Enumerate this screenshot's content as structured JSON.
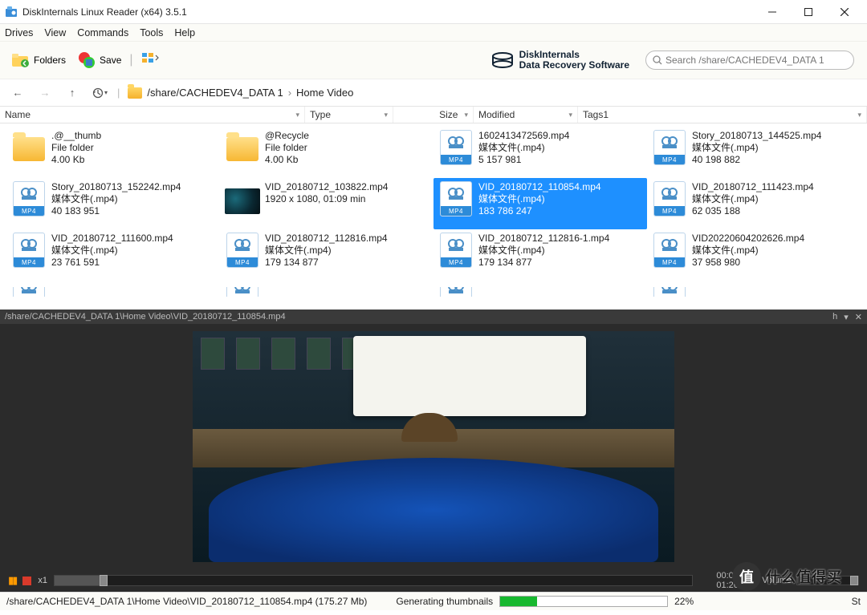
{
  "window": {
    "title": "DiskInternals Linux Reader (x64) 3.5.1"
  },
  "menu": {
    "drives": "Drives",
    "view": "View",
    "commands": "Commands",
    "tools": "Tools",
    "help": "Help"
  },
  "toolbar": {
    "folders": "Folders",
    "save": "Save"
  },
  "brand": {
    "line1": "DiskInternals",
    "line2": "Data Recovery Software"
  },
  "search": {
    "placeholder": "Search /share/CACHEDEV4_DATA 1"
  },
  "breadcrumb": {
    "seg1": "/share/CACHEDEV4_DATA 1",
    "seg2": "Home Video"
  },
  "columns": {
    "name": "Name",
    "type": "Type",
    "size": "Size",
    "modified": "Modified",
    "tags1": "Tags1"
  },
  "files": [
    {
      "name": ".@__thumb",
      "type": "File folder",
      "meta": "4.00 Kb",
      "kind": "folder"
    },
    {
      "name": "@Recycle",
      "type": "File folder",
      "meta": "4.00 Kb",
      "kind": "folder"
    },
    {
      "name": "1602413472569.mp4",
      "type": "媒体文件(.mp4)",
      "meta": "5 157 981",
      "kind": "mp4"
    },
    {
      "name": "Story_20180713_144525.mp4",
      "type": "媒体文件(.mp4)",
      "meta": "40 198 882",
      "kind": "mp4"
    },
    {
      "name": "Story_20180713_152242.mp4",
      "type": "媒体文件(.mp4)",
      "meta": "40 183 951",
      "kind": "mp4"
    },
    {
      "name": "VID_20180712_103822.mp4",
      "type": "1920 x 1080, 01:09 min",
      "meta": "",
      "kind": "thumb"
    },
    {
      "name": "VID_20180712_110854.mp4",
      "type": "媒体文件(.mp4)",
      "meta": "183 786 247",
      "kind": "mp4",
      "selected": true
    },
    {
      "name": "VID_20180712_111423.mp4",
      "type": "媒体文件(.mp4)",
      "meta": "62 035 188",
      "kind": "mp4"
    },
    {
      "name": "VID_20180712_111600.mp4",
      "type": "媒体文件(.mp4)",
      "meta": "23 761 591",
      "kind": "mp4"
    },
    {
      "name": "VID_20180712_112816.mp4",
      "type": "媒体文件(.mp4)",
      "meta": "179 134 877",
      "kind": "mp4"
    },
    {
      "name": "VID_20180712_112816-1.mp4",
      "type": "媒体文件(.mp4)",
      "meta": "179 134 877",
      "kind": "mp4"
    },
    {
      "name": "VID20220604202626.mp4",
      "type": "媒体文件(.mp4)",
      "meta": "37 958 980",
      "kind": "mp4"
    }
  ],
  "preview": {
    "path": "/share/CACHEDEV4_DATA 1\\Home Video\\VID_20180712_110854.mp4",
    "rate": "x1",
    "elapsed": "00:05.349",
    "total": "01:26.256",
    "volume_label": "Volume",
    "h_label": "h"
  },
  "status": {
    "path": "/share/CACHEDEV4_DATA 1\\Home Video\\VID_20180712_110854.mp4 (175.27 Mb)",
    "task": "Generating thumbnails",
    "percent": "22%",
    "tail": "St"
  },
  "watermark": {
    "char": "值",
    "text": "什么值得买"
  },
  "icons": {
    "mp4": "MP4"
  }
}
